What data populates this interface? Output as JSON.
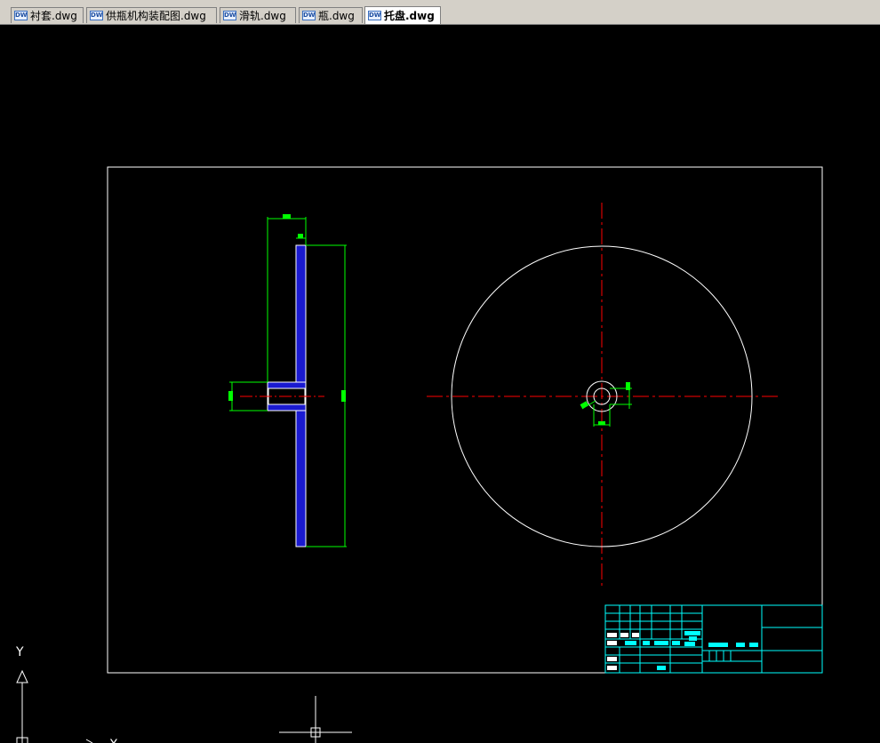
{
  "tabs": [
    {
      "label": "衬套.dwg",
      "icon": "dwg-file-icon",
      "active": false
    },
    {
      "label": "供瓶机构装配图.dwg",
      "icon": "dwg-file-icon",
      "active": false
    },
    {
      "label": "滑轨.dwg",
      "icon": "dwg-file-icon",
      "active": false
    },
    {
      "label": "瓶.dwg",
      "icon": "dwg-file-icon",
      "active": false
    },
    {
      "label": "托盘.dwg",
      "icon": "dwg-file-icon",
      "active": true
    }
  ],
  "ucs": {
    "y_label": "Y",
    "x_label": "X"
  },
  "colors": {
    "background": "#000000",
    "border": "#ffffff",
    "dimension": "#00ff00",
    "centerline": "#ff0000",
    "section_fill": "#1a1ad0",
    "title_block": "#00ffff"
  }
}
